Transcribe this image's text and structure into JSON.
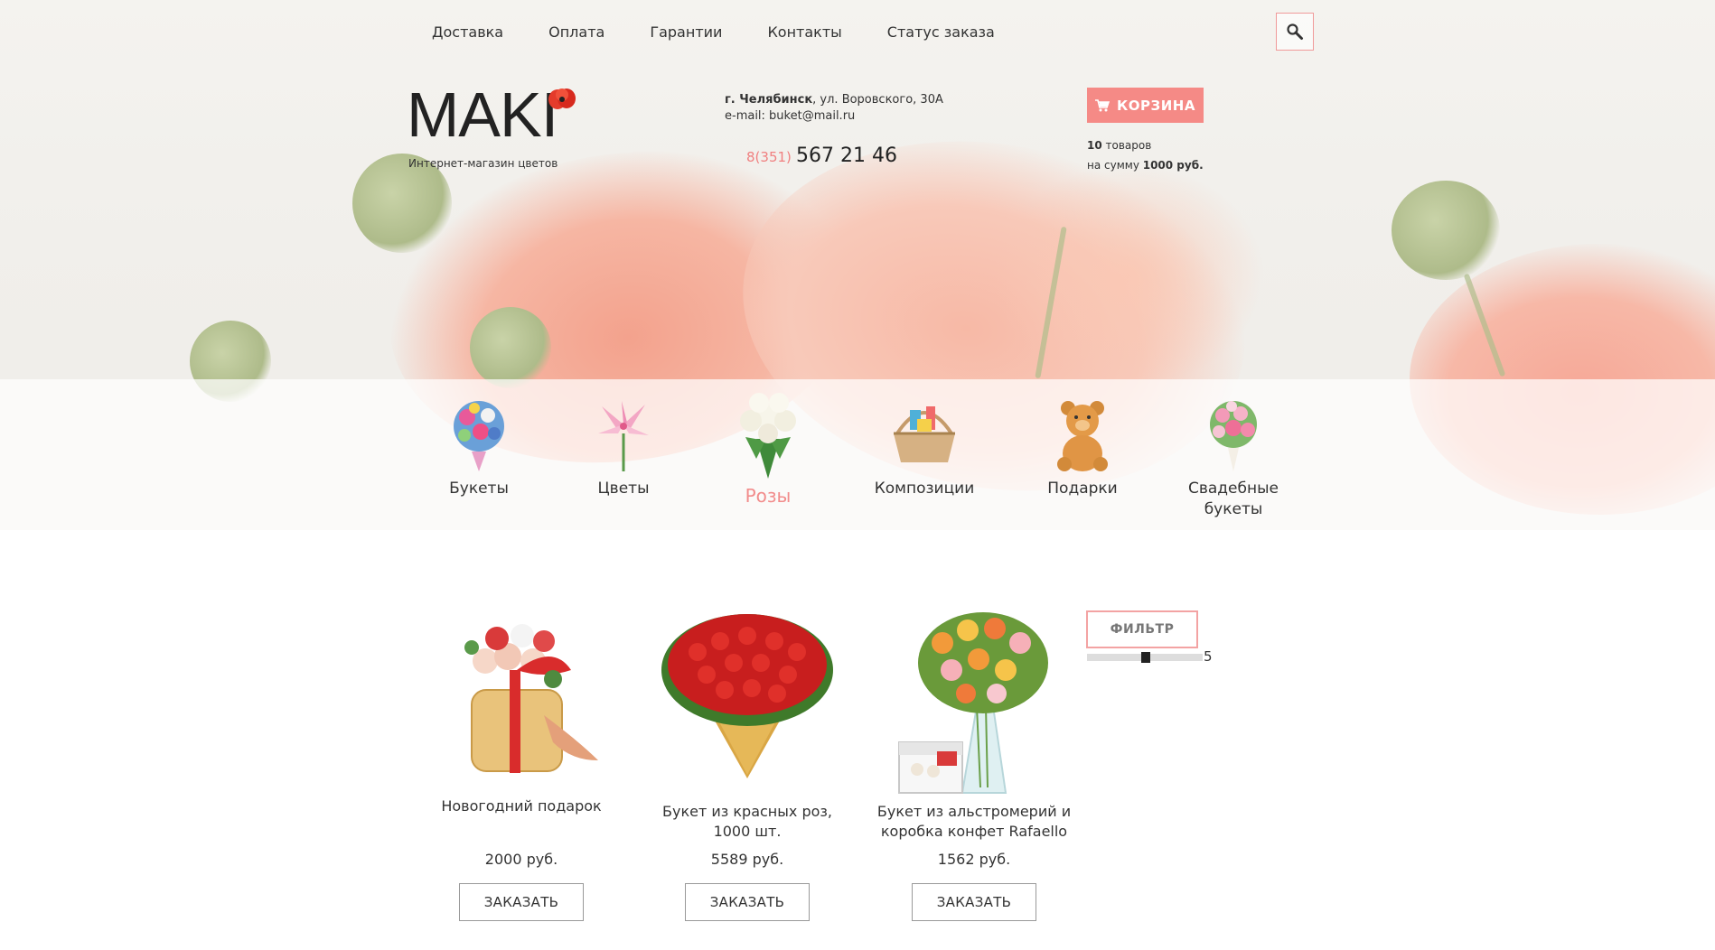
{
  "topnav": {
    "items": [
      "Доставка",
      "Оплата",
      "Гарантии",
      "Контакты",
      "Статус заказа"
    ]
  },
  "logo": {
    "text": "MAKI",
    "subtitle": "Интернет-магазин цветов"
  },
  "contacts": {
    "city": "г. Челябинск",
    "address": ", ул. Воровского, 30А",
    "email": "e-mail: buket@mail.ru",
    "phone_code": "8(351)",
    "phone_number": "567 21 46"
  },
  "cart": {
    "button_label": "КОРЗИНА",
    "count": "10",
    "count_suffix": " товаров",
    "sum_prefix": "на сумму ",
    "sum": "1000 руб."
  },
  "categories": [
    {
      "label": "Букеты",
      "icon": "bouquet-icon"
    },
    {
      "label": "Цветы",
      "icon": "lily-icon"
    },
    {
      "label": "Розы",
      "icon": "roses-icon",
      "active": true
    },
    {
      "label": "Композиции",
      "icon": "basket-icon"
    },
    {
      "label": "Подарки",
      "icon": "teddy-bear-icon"
    },
    {
      "label": "Свадебные букеты",
      "icon": "wedding-bouquet-icon"
    }
  ],
  "products": [
    {
      "name": "Новогодний подарок",
      "price": "2000 руб.",
      "button": "ЗАКАЗАТЬ"
    },
    {
      "name": "Букет из красных роз, 1000 шт.",
      "price": "5589 руб.",
      "button": "ЗАКАЗАТЬ"
    },
    {
      "name": "Букет из альстромерий и коробка конфет Rafaello",
      "price": "1562 руб.",
      "button": "ЗАКАЗАТЬ"
    }
  ],
  "filter": {
    "label": "ФИЛЬТР",
    "slider_value": "5"
  },
  "colors": {
    "accent": "#f58a86",
    "active_category": "#f28c8c",
    "text": "#333333"
  }
}
